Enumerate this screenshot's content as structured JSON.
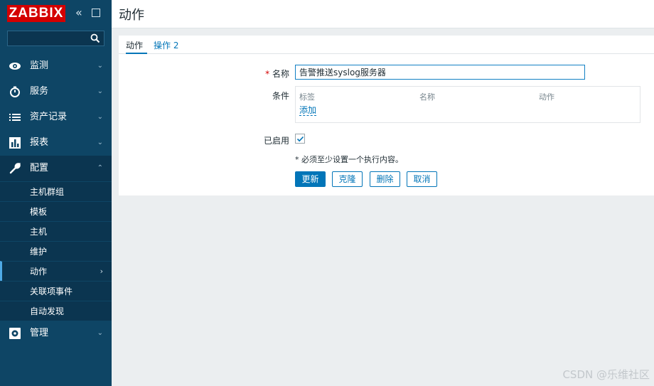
{
  "brand": {
    "logo_text": "ZABBIX",
    "logo_color": "#d40000"
  },
  "search": {
    "value": "",
    "placeholder": ""
  },
  "sidebar": {
    "items": [
      {
        "label": "监测",
        "icon": "eye-icon"
      },
      {
        "label": "服务",
        "icon": "stopwatch-icon"
      },
      {
        "label": "资产记录",
        "icon": "list-icon"
      },
      {
        "label": "报表",
        "icon": "bar-chart-icon"
      },
      {
        "label": "配置",
        "icon": "wrench-icon",
        "expanded": true
      },
      {
        "label": "管理",
        "icon": "gear-icon"
      }
    ],
    "config_sub": [
      {
        "label": "主机群组"
      },
      {
        "label": "模板"
      },
      {
        "label": "主机"
      },
      {
        "label": "维护"
      },
      {
        "label": "动作",
        "selected": true
      },
      {
        "label": "关联项事件"
      },
      {
        "label": "自动发现"
      }
    ]
  },
  "header": {
    "title": "动作"
  },
  "tabs": {
    "action": "动作",
    "operations": "操作 2"
  },
  "form": {
    "required_mark": "*",
    "name_label": "名称",
    "name_value": "告警推送syslog服务器",
    "conditions_label": "条件",
    "conditions_columns": [
      "标签",
      "名称",
      "动作"
    ],
    "conditions_add": "添加",
    "enabled_label": "已启用",
    "enabled_checked": true,
    "notice": "* 必须至少设置一个执行内容。"
  },
  "buttons": {
    "update": "更新",
    "clone": "克隆",
    "delete": "删除",
    "cancel": "取消"
  },
  "watermark": "CSDN @乐维社区",
  "colors": {
    "sidebar": "#0e4565",
    "accent": "#0275b8"
  }
}
